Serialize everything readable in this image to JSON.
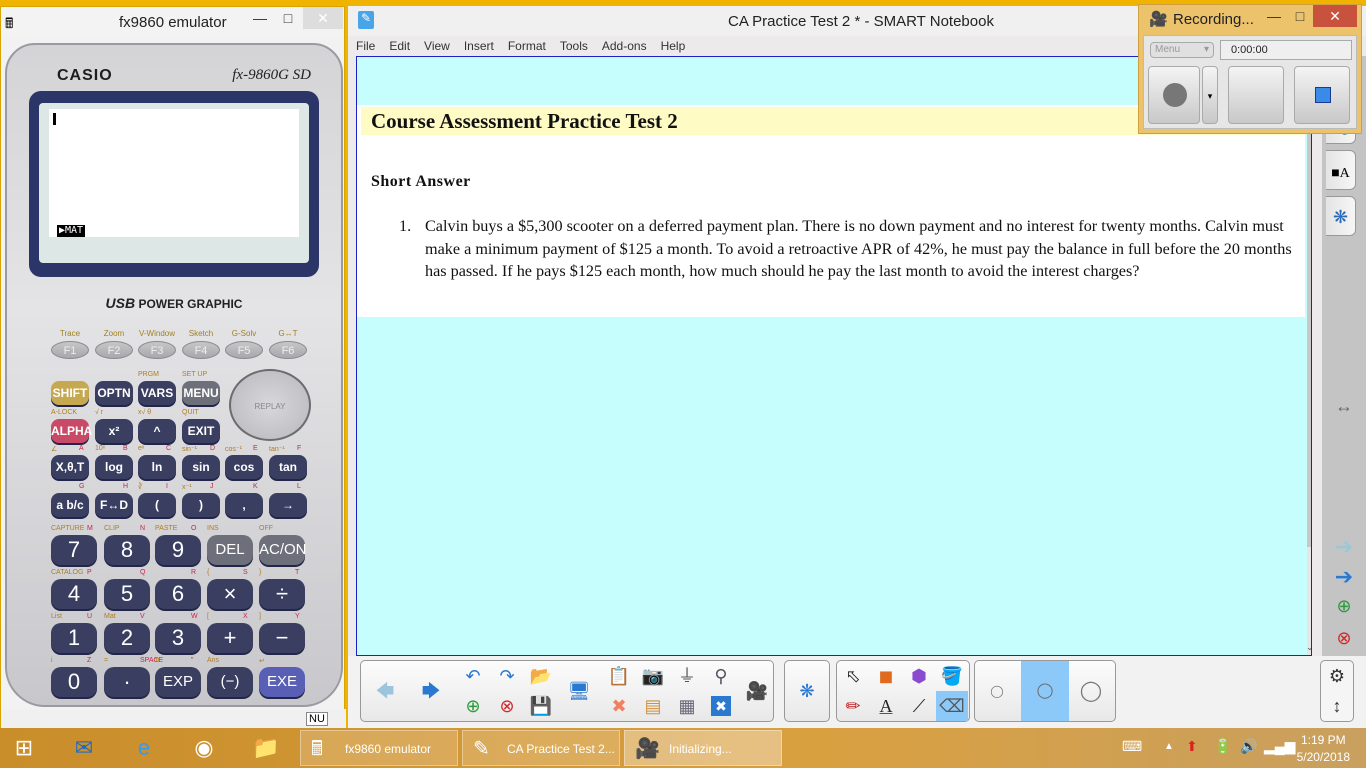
{
  "emulator": {
    "title": "fx9860 emulator",
    "brand": "CASIO",
    "model": "fx-9860G SD",
    "screen_softkey": "▶MAT",
    "subtitle_prefix": "USB",
    "subtitle": "POWER GRAPHIC",
    "replay_label": "REPLAY",
    "status_nu": "NU",
    "function_keys": [
      {
        "label": "F1",
        "shift": "Trace"
      },
      {
        "label": "F2",
        "shift": "Zoom"
      },
      {
        "label": "F3",
        "shift": "V-Window"
      },
      {
        "label": "F4",
        "shift": "Sketch"
      },
      {
        "label": "F5",
        "shift": "G-Solv"
      },
      {
        "label": "F6",
        "shift": "G↔T"
      }
    ],
    "row1": [
      {
        "label": "SHIFT",
        "above": ""
      },
      {
        "label": "OPTN",
        "above": ""
      },
      {
        "label": "VARS",
        "above": "PRGM"
      },
      {
        "label": "MENU",
        "above": "SET UP"
      }
    ],
    "row2": [
      {
        "label": "ALPHA",
        "above": "A-LOCK"
      },
      {
        "label": "x²",
        "above": "√  r"
      },
      {
        "label": "^",
        "above": "x√  θ"
      },
      {
        "label": "EXIT",
        "above": "QUIT"
      }
    ],
    "row3": [
      {
        "label": "X,θ,T",
        "above": "∠",
        "alpha": "A"
      },
      {
        "label": "log",
        "above": "10ˣ",
        "alpha": "B"
      },
      {
        "label": "ln",
        "above": "eˣ",
        "alpha": "C"
      },
      {
        "label": "sin",
        "above": "sin⁻¹",
        "alpha": "D"
      },
      {
        "label": "cos",
        "above": "cos⁻¹",
        "alpha": "E"
      },
      {
        "label": "tan",
        "above": "tan⁻¹",
        "alpha": "F"
      }
    ],
    "row4": [
      {
        "label": "a b/c",
        "above": "",
        "alpha": "G"
      },
      {
        "label": "F↔D",
        "above": "",
        "alpha": "H"
      },
      {
        "label": "(",
        "above": "∛",
        "alpha": "I"
      },
      {
        "label": ")",
        "above": "x⁻¹",
        "alpha": "J"
      },
      {
        "label": ",",
        "above": "",
        "alpha": "K"
      },
      {
        "label": "→",
        "above": "",
        "alpha": "L"
      }
    ],
    "row5": [
      {
        "label": "7",
        "above": "CAPTURE",
        "alpha": "M"
      },
      {
        "label": "8",
        "above": "CLIP",
        "alpha": "N"
      },
      {
        "label": "9",
        "above": "PASTE",
        "alpha": "O"
      },
      {
        "label": "DEL",
        "above": "INS",
        "alpha": ""
      },
      {
        "label": "AC/ON",
        "above": "OFF",
        "alpha": ""
      }
    ],
    "row6": [
      {
        "label": "4",
        "above": "CATALOG",
        "alpha": "P"
      },
      {
        "label": "5",
        "above": "",
        "alpha": "Q"
      },
      {
        "label": "6",
        "above": "",
        "alpha": "R"
      },
      {
        "label": "×",
        "above": "{",
        "alpha": "S"
      },
      {
        "label": "÷",
        "above": "}",
        "alpha": "T"
      }
    ],
    "row7": [
      {
        "label": "1",
        "above": "List",
        "alpha": "U"
      },
      {
        "label": "2",
        "above": "Mat",
        "alpha": "V"
      },
      {
        "label": "3",
        "above": "",
        "alpha": "W"
      },
      {
        "label": "+",
        "above": "[",
        "alpha": "X"
      },
      {
        "label": "−",
        "above": "]",
        "alpha": "Y"
      }
    ],
    "row8": [
      {
        "label": "0",
        "above": "i",
        "alpha": "Z"
      },
      {
        "label": "·",
        "above": "=",
        "alpha": "SPACE"
      },
      {
        "label": "EXP",
        "above": "π",
        "alpha": "”"
      },
      {
        "label": "(−)",
        "above": "Ans",
        "alpha": ""
      },
      {
        "label": "EXE",
        "above": "↵",
        "alpha": ""
      }
    ]
  },
  "smart": {
    "title": "CA Practice Test 2 * - SMART Notebook",
    "menu": [
      "File",
      "Edit",
      "View",
      "Insert",
      "Format",
      "Tools",
      "Add-ons",
      "Help"
    ],
    "doc": {
      "heading": "Course Assessment Practice Test 2",
      "section": "Short Answer",
      "question_number": "1.",
      "question_text": "Calvin buys a $5,300 scooter on a deferred payment plan. There is no down payment and no interest for twenty months. Calvin must make a minimum payment of $125 a month. To avoid a retroactive APR of 42%, he must pay the balance in full before the 20 months has passed. If he pays $125 each month, how much should he pay the last month to avoid the interest charges?"
    },
    "sidebar_icons": [
      "page-sorter-icon",
      "attachments-icon",
      "properties-icon",
      "addons-icon",
      "resize-horizontal-icon",
      "previous-page-icon",
      "next-page-icon",
      "add-page-icon",
      "delete-page-icon"
    ],
    "toolbar_icons": [
      "back",
      "forward",
      "undo",
      "redo",
      "open",
      "add-page",
      "delete-page",
      "save",
      "display-screens",
      "paste",
      "capture",
      "document-camera",
      "measurement-tools",
      "delete",
      "screen-shade",
      "table",
      "smart-response",
      "recorder",
      "addons",
      "select",
      "shapes",
      "regular-polygons",
      "fill",
      "pens",
      "text",
      "lines",
      "eraser",
      "eraser-small",
      "eraser-medium",
      "eraser-large"
    ]
  },
  "recorder": {
    "title": "Recording...",
    "menu_label": "Menu",
    "time": "0:00:00"
  },
  "taskbar": {
    "tasks": [
      {
        "label": "fx9860 emulator"
      },
      {
        "label": "CA Practice Test 2..."
      },
      {
        "label": "Initializing..."
      }
    ],
    "time": "1:19 PM",
    "date": "5/20/2018"
  }
}
